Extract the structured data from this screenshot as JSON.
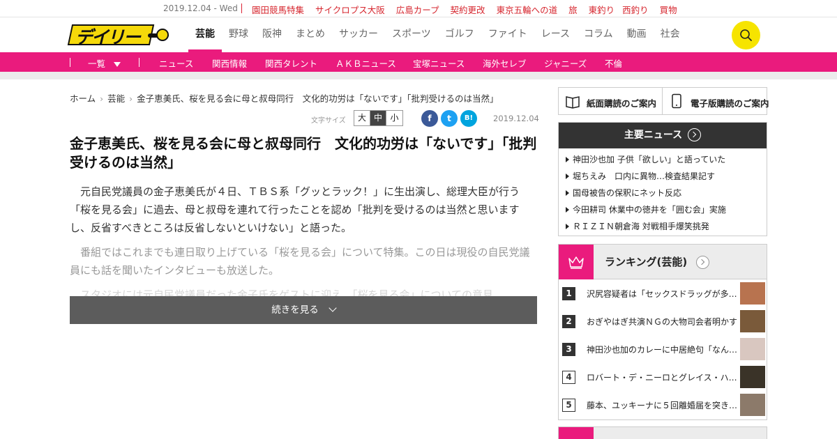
{
  "topbar": {
    "date": "2019.12.04 - Wed",
    "links": [
      "園田競馬特集",
      "サイクロプス大阪",
      "広島カープ",
      "契約更改",
      "東京五輪への道",
      "旅",
      "東釣り",
      "西釣り",
      "買物"
    ]
  },
  "header": {
    "logo_text": "デイリー",
    "nav": [
      "芸能",
      "野球",
      "阪神",
      "まとめ",
      "サッカー",
      "スポーツ",
      "ゴルフ",
      "ファイト",
      "レース",
      "コラム",
      "動画",
      "社会"
    ],
    "active_nav": "芸能",
    "search_icon": "search-icon"
  },
  "subnav": {
    "dropdown_label": "一覧",
    "items": [
      "ニュース",
      "関西情報",
      "関西タレント",
      "ＡＫＢニュース",
      "宝塚ニュース",
      "海外セレブ",
      "ジャニーズ",
      "不倫"
    ]
  },
  "article": {
    "breadcrumb": [
      "ホーム",
      "芸能",
      "金子恵美氏、桜を見る会に母と叔母同行　文化的功労は「ないです」「批判受けるのは当然」"
    ],
    "font_size_label": "文字サイズ",
    "font_sizes": [
      "大",
      "中",
      "小"
    ],
    "font_size_selected": "中",
    "share": {
      "facebook": "f",
      "twitter": "t",
      "hatena": "B!"
    },
    "date": "2019.12.04",
    "headline": "金子恵美氏、桜を見る会に母と叔母同行　文化的功労は「ないです」「批判受けるのは当然」",
    "paragraphs": [
      "元自民党議員の金子恵美氏が４日、ＴＢＳ系「グッとラック！」に生出演し、総理大臣が行う「桜を見る会」に過去、母と叔母を連れて行ったことを認め「批判を受けるのは当然と思いますし、反省すべきところは反省しないといけない」と語った。",
      "番組ではこれまでも連日取り上げている「桜を見る会」について特集。この日は現役の自民党議員にも話を聞いたインタビューも放送した。",
      "スタジオには元自民党議員だった金子氏をゲストに迎え、「桜を見る会」についての意見"
    ],
    "read_more": "続きを見る"
  },
  "sidebar": {
    "subscriptions": [
      "紙面購読のご案内",
      "電子版購読のご案内"
    ],
    "main_news": {
      "title": "主要ニュース",
      "items": [
        "神田沙也加 子供「欲しい」と語っていた",
        "堀ちえみ　口内に異物…検査結果記す",
        "国母被告の保釈にネット反応",
        "今田耕司 休業中の徳井を「囲む会」実施",
        "ＲＩＺＩＮ朝倉海 対戦相手爆笑挑発"
      ]
    },
    "ranking": {
      "title": "ランキング(芸能)",
      "items": [
        {
          "rank": "1",
          "text": "沢尻容疑者は「セックスドラッグが多…",
          "thumb_color": "#b8734f"
        },
        {
          "rank": "2",
          "text": "おぎやはぎ共演ＮＧの大物司会者明かす",
          "thumb_color": "#7a5a3a"
        },
        {
          "rank": "3",
          "text": "神田沙也加のカレーに中居絶句「なん…",
          "thumb_color": "#d9c7c0"
        },
        {
          "rank": "4",
          "text": "ロバート・デ・ニーロとグレイス・ハ…",
          "thumb_color": "#3a3328"
        },
        {
          "rank": "5",
          "text": "藤本、ユッキーナに５回離婚届を突き…",
          "thumb_color": "#8c7a6a"
        }
      ]
    }
  },
  "colors": {
    "brand_pink": "#ea1b7d",
    "brand_yellow": "#f6e400",
    "link_red": "#d6262e"
  }
}
